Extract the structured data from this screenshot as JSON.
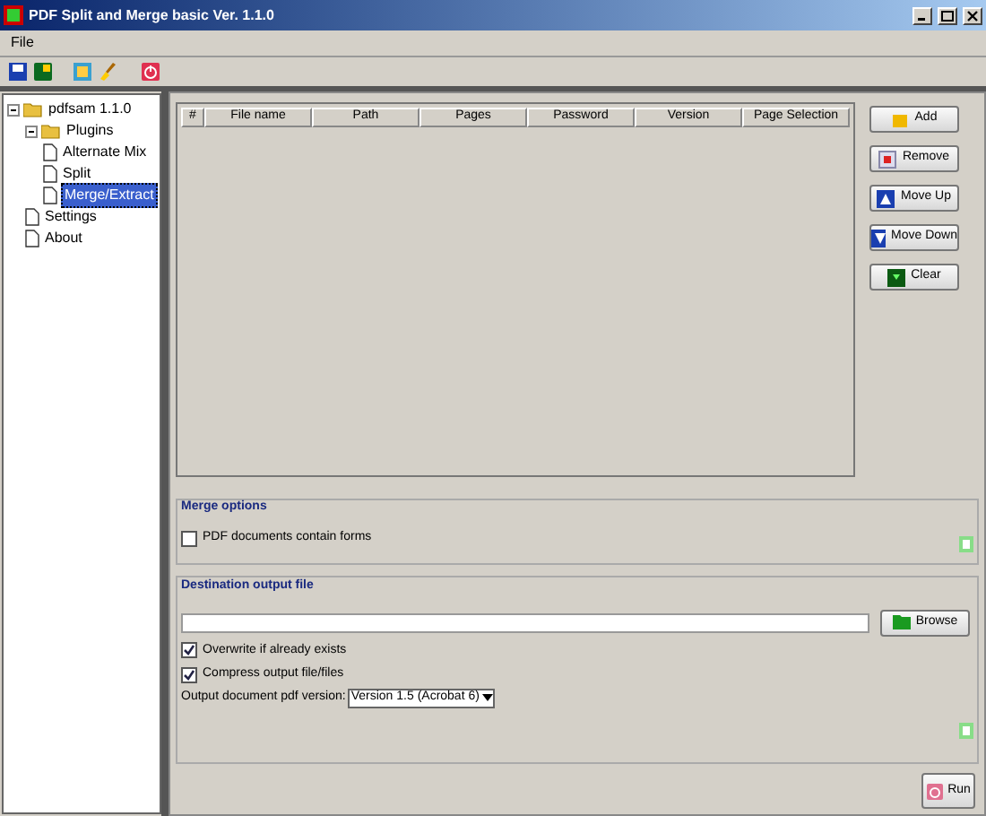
{
  "window": {
    "title": "PDF Split and Merge basic Ver. 1.1.0"
  },
  "menu": [
    "File"
  ],
  "tree": [
    {
      "label": "pdfsam 1.1.0",
      "kind": "folder",
      "selected": false,
      "expanded": true,
      "children": [
        {
          "label": "Plugins",
          "kind": "folder",
          "selected": false,
          "expanded": true,
          "children": [
            {
              "label": "Alternate Mix",
              "kind": "page",
              "selected": false
            },
            {
              "label": "Split",
              "kind": "page",
              "selected": false
            },
            {
              "label": "Merge/Extract",
              "kind": "page",
              "selected": true
            }
          ]
        },
        {
          "label": "Settings",
          "kind": "page",
          "selected": false
        },
        {
          "label": "About",
          "kind": "page",
          "selected": false
        }
      ]
    }
  ],
  "table": {
    "columns": [
      "#",
      "File name",
      "Path",
      "Pages",
      "Password",
      "Version",
      "Page Selection"
    ]
  },
  "side_buttons": [
    {
      "label": "Add",
      "kind": "add"
    },
    {
      "label": "Remove",
      "kind": "remove"
    },
    {
      "label": "Move Up",
      "kind": "up"
    },
    {
      "label": "Move Down",
      "kind": "down"
    },
    {
      "label": "Clear",
      "kind": "clear"
    }
  ],
  "merge_options": {
    "title": "Merge options",
    "checkbox": {
      "label": "PDF documents contain forms",
      "checked": false
    }
  },
  "destination": {
    "title": "Destination output file",
    "browse": "Browse",
    "checkboxes": [
      {
        "label": "Overwrite if already exists",
        "checked": true
      },
      {
        "label": "Compress output file/files",
        "checked": true
      }
    ],
    "version_label": "Output document pdf version:",
    "version_value": "Version 1.5 (Acrobat 6)"
  },
  "run": "Run"
}
